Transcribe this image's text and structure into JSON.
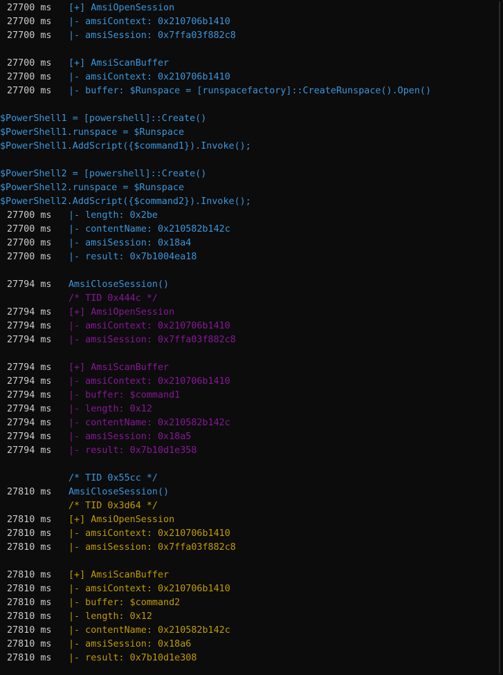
{
  "colors": {
    "background": "#0c0c0c",
    "default_text": "#cccccc",
    "blue": "#3a96dd",
    "magenta": "#881798",
    "yellow": "#c19c00"
  },
  "lines": [
    {
      "ts": "27700 ms",
      "text": "[+] AmsiOpenSession",
      "color": "blue"
    },
    {
      "ts": "27700 ms",
      "text": "|- amsiContext: 0x210706b1410",
      "color": "blue"
    },
    {
      "ts": "27700 ms",
      "text": "|- amsiSession: 0x7ffa03f882c8",
      "color": "blue"
    },
    {
      "ts": "",
      "text": "",
      "color": "white"
    },
    {
      "ts": "27700 ms",
      "text": "[+] AmsiScanBuffer",
      "color": "blue"
    },
    {
      "ts": "27700 ms",
      "text": "|- amsiContext: 0x210706b1410",
      "color": "blue"
    },
    {
      "ts": "27700 ms",
      "text": "|- buffer: $Runspace = [runspacefactory]::CreateRunspace().Open()",
      "color": "blue"
    },
    {
      "ts": "",
      "text": "",
      "color": "white"
    },
    {
      "raw": true,
      "text": "$PowerShell1 = [powershell]::Create()",
      "color": "blue"
    },
    {
      "raw": true,
      "text": "$PowerShell1.runspace = $Runspace",
      "color": "blue"
    },
    {
      "raw": true,
      "text": "$PowerShell1.AddScript({$command1}).Invoke();",
      "color": "blue"
    },
    {
      "ts": "",
      "text": "",
      "color": "white"
    },
    {
      "raw": true,
      "text": "$PowerShell2 = [powershell]::Create()",
      "color": "blue"
    },
    {
      "raw": true,
      "text": "$PowerShell2.runspace = $Runspace",
      "color": "blue"
    },
    {
      "raw": true,
      "text": "$PowerShell2.AddScript({$command2}).Invoke();",
      "color": "blue"
    },
    {
      "ts": "27700 ms",
      "text": "|- length: 0x2be",
      "color": "blue"
    },
    {
      "ts": "27700 ms",
      "text": "|- contentName: 0x210582b142c",
      "color": "blue"
    },
    {
      "ts": "27700 ms",
      "text": "|- amsiSession: 0x18a4",
      "color": "blue"
    },
    {
      "ts": "27700 ms",
      "text": "|- result: 0x7b1004ea18",
      "color": "blue"
    },
    {
      "ts": "",
      "text": "",
      "color": "white"
    },
    {
      "ts": "27794 ms",
      "text": "AmsiCloseSession()",
      "color": "blue"
    },
    {
      "ts": "",
      "text": "/* TID 0x444c */",
      "color": "magenta"
    },
    {
      "ts": "27794 ms",
      "text": "[+] AmsiOpenSession",
      "color": "magenta"
    },
    {
      "ts": "27794 ms",
      "text": "|- amsiContext: 0x210706b1410",
      "color": "magenta"
    },
    {
      "ts": "27794 ms",
      "text": "|- amsiSession: 0x7ffa03f882c8",
      "color": "magenta"
    },
    {
      "ts": "",
      "text": "",
      "color": "white"
    },
    {
      "ts": "27794 ms",
      "text": "[+] AmsiScanBuffer",
      "color": "magenta"
    },
    {
      "ts": "27794 ms",
      "text": "|- amsiContext: 0x210706b1410",
      "color": "magenta"
    },
    {
      "ts": "27794 ms",
      "text": "|- buffer: $command1",
      "color": "magenta"
    },
    {
      "ts": "27794 ms",
      "text": "|- length: 0x12",
      "color": "magenta"
    },
    {
      "ts": "27794 ms",
      "text": "|- contentName: 0x210582b142c",
      "color": "magenta"
    },
    {
      "ts": "27794 ms",
      "text": "|- amsiSession: 0x18a5",
      "color": "magenta"
    },
    {
      "ts": "27794 ms",
      "text": "|- result: 0x7b10d1e358",
      "color": "magenta"
    },
    {
      "ts": "",
      "text": "",
      "color": "white"
    },
    {
      "ts": "",
      "text": "/* TID 0x55cc */",
      "color": "blue"
    },
    {
      "ts": "27810 ms",
      "text": "AmsiCloseSession()",
      "color": "blue"
    },
    {
      "ts": "",
      "text": "/* TID 0x3d64 */",
      "color": "yellow"
    },
    {
      "ts": "27810 ms",
      "text": "[+] AmsiOpenSession",
      "color": "yellow"
    },
    {
      "ts": "27810 ms",
      "text": "|- amsiContext: 0x210706b1410",
      "color": "yellow"
    },
    {
      "ts": "27810 ms",
      "text": "|- amsiSession: 0x7ffa03f882c8",
      "color": "yellow"
    },
    {
      "ts": "",
      "text": "",
      "color": "white"
    },
    {
      "ts": "27810 ms",
      "text": "[+] AmsiScanBuffer",
      "color": "yellow"
    },
    {
      "ts": "27810 ms",
      "text": "|- amsiContext: 0x210706b1410",
      "color": "yellow"
    },
    {
      "ts": "27810 ms",
      "text": "|- buffer: $command2",
      "color": "yellow"
    },
    {
      "ts": "27810 ms",
      "text": "|- length: 0x12",
      "color": "yellow"
    },
    {
      "ts": "27810 ms",
      "text": "|- contentName: 0x210582b142c",
      "color": "yellow"
    },
    {
      "ts": "27810 ms",
      "text": "|- amsiSession: 0x18a6",
      "color": "yellow"
    },
    {
      "ts": "27810 ms",
      "text": "|- result: 0x7b10d1e308",
      "color": "yellow"
    }
  ]
}
